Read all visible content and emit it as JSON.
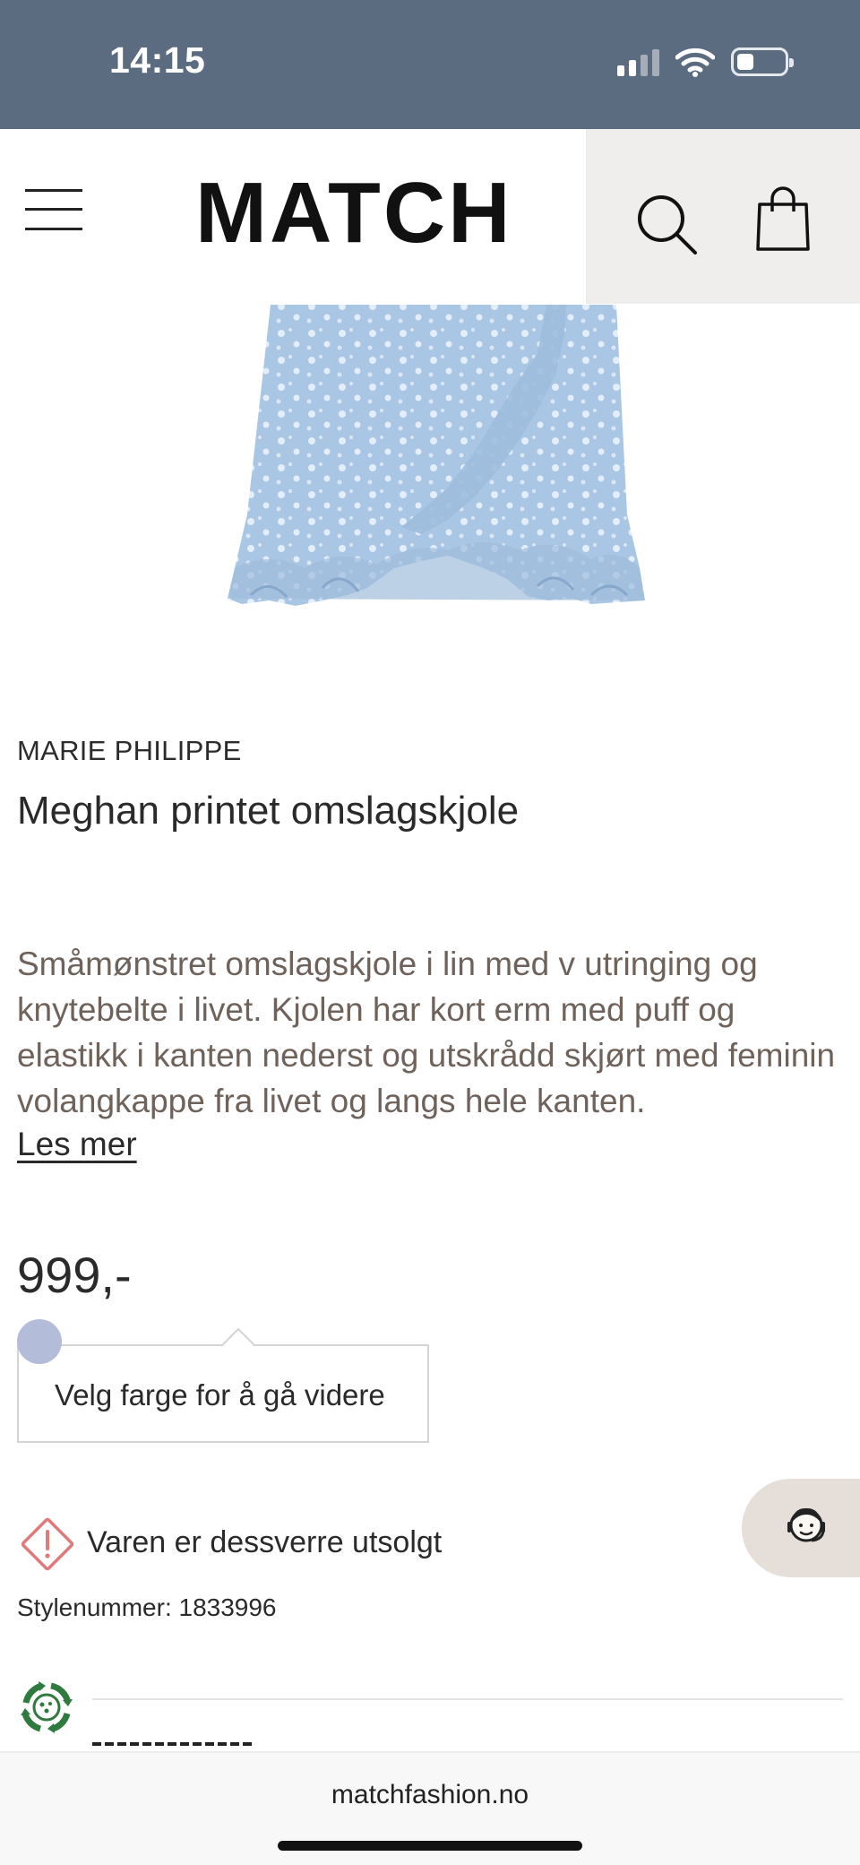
{
  "status_bar": {
    "time": "14:15",
    "icons": [
      "cellular-signal-icon",
      "wifi-icon",
      "battery-icon"
    ]
  },
  "header": {
    "logo": "MATCH",
    "icons": [
      "hamburger-menu-icon",
      "search-icon",
      "shopping-bag-icon"
    ]
  },
  "product": {
    "image_description": "light blue floral wrap dress ruffle hem",
    "brand": "MARIE PHILIPPE",
    "title": "Meghan printet omslagskjole",
    "description": "Småmønstret omslagskjole i lin med v utringing og knytebelte i livet. Kjolen har kort erm med puff og elastikk i kanten nederst og utskrådd skjørt med feminin volangkappe fra livet og langs hele kanten.",
    "read_more": "Les mer",
    "price": "999,-",
    "color_swatch": "#b3bcd8",
    "color_prompt": "Velg farge for å gå videre",
    "stock_status": "Varen er dessverre utsolgt",
    "style_number": "Stylenummer: 1833996"
  },
  "colors": {
    "status_bar_bg": "#5b6b80",
    "accent_warning": "#e07a7a",
    "eco_green": "#2f7a3e",
    "description_text": "#6e625a"
  },
  "browser": {
    "url": "matchfashion.no"
  }
}
